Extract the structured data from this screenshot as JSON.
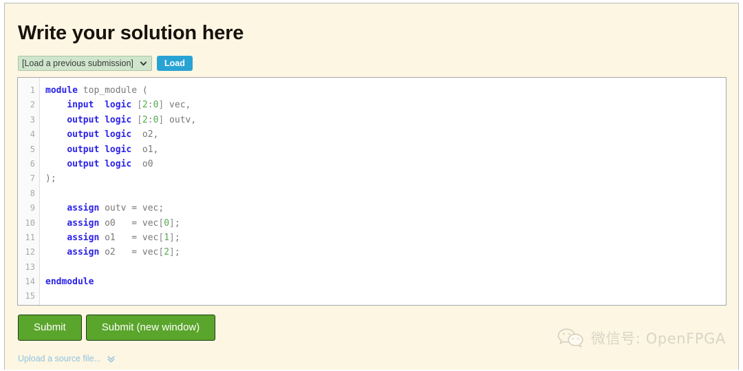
{
  "page": {
    "title": "Write your solution here",
    "background_color": "#fdf6e3"
  },
  "load_row": {
    "select": {
      "selected": "[Load a previous submission]",
      "options": [
        "[Load a previous submission]"
      ],
      "caret_icon": "chevron-down-icon"
    },
    "load_button": {
      "label": "Load",
      "color": "#28a3d4"
    }
  },
  "editor": {
    "line_numbers": [
      "1",
      "2",
      "3",
      "4",
      "5",
      "6",
      "7",
      "8",
      "9",
      "10",
      "11",
      "12",
      "13",
      "14",
      "15"
    ],
    "lines": [
      {
        "n": "1",
        "tokens": [
          {
            "t": "module",
            "c": "kw"
          },
          {
            "t": " top_module (",
            "c": "id"
          }
        ]
      },
      {
        "n": "2",
        "tokens": [
          {
            "t": "    ",
            "c": "id"
          },
          {
            "t": "input",
            "c": "kw"
          },
          {
            "t": "  ",
            "c": "id"
          },
          {
            "t": "logic",
            "c": "kw"
          },
          {
            "t": " ",
            "c": "id"
          },
          {
            "t": "[",
            "c": "punct"
          },
          {
            "t": "2",
            "c": "num"
          },
          {
            "t": ":",
            "c": "punct"
          },
          {
            "t": "0",
            "c": "num"
          },
          {
            "t": "]",
            "c": "punct"
          },
          {
            "t": " vec,",
            "c": "id"
          }
        ]
      },
      {
        "n": "3",
        "tokens": [
          {
            "t": "    ",
            "c": "id"
          },
          {
            "t": "output",
            "c": "kw"
          },
          {
            "t": " ",
            "c": "id"
          },
          {
            "t": "logic",
            "c": "kw"
          },
          {
            "t": " ",
            "c": "id"
          },
          {
            "t": "[",
            "c": "punct"
          },
          {
            "t": "2",
            "c": "num"
          },
          {
            "t": ":",
            "c": "punct"
          },
          {
            "t": "0",
            "c": "num"
          },
          {
            "t": "]",
            "c": "punct"
          },
          {
            "t": " outv,",
            "c": "id"
          }
        ]
      },
      {
        "n": "4",
        "tokens": [
          {
            "t": "    ",
            "c": "id"
          },
          {
            "t": "output",
            "c": "kw"
          },
          {
            "t": " ",
            "c": "id"
          },
          {
            "t": "logic",
            "c": "kw"
          },
          {
            "t": "  o2,",
            "c": "id"
          }
        ]
      },
      {
        "n": "5",
        "tokens": [
          {
            "t": "    ",
            "c": "id"
          },
          {
            "t": "output",
            "c": "kw"
          },
          {
            "t": " ",
            "c": "id"
          },
          {
            "t": "logic",
            "c": "kw"
          },
          {
            "t": "  o1,",
            "c": "id"
          }
        ]
      },
      {
        "n": "6",
        "tokens": [
          {
            "t": "    ",
            "c": "id"
          },
          {
            "t": "output",
            "c": "kw"
          },
          {
            "t": " ",
            "c": "id"
          },
          {
            "t": "logic",
            "c": "kw"
          },
          {
            "t": "  o0",
            "c": "id"
          }
        ]
      },
      {
        "n": "7",
        "tokens": [
          {
            "t": ");",
            "c": "id"
          }
        ]
      },
      {
        "n": "8",
        "tokens": [
          {
            "t": "",
            "c": "id"
          }
        ]
      },
      {
        "n": "9",
        "tokens": [
          {
            "t": "    ",
            "c": "id"
          },
          {
            "t": "assign",
            "c": "kw"
          },
          {
            "t": " outv = vec;",
            "c": "id"
          }
        ]
      },
      {
        "n": "10",
        "tokens": [
          {
            "t": "    ",
            "c": "id"
          },
          {
            "t": "assign",
            "c": "kw"
          },
          {
            "t": " o0   = vec",
            "c": "id"
          },
          {
            "t": "[",
            "c": "punct"
          },
          {
            "t": "0",
            "c": "num"
          },
          {
            "t": "]",
            "c": "punct"
          },
          {
            "t": ";",
            "c": "id"
          }
        ]
      },
      {
        "n": "11",
        "tokens": [
          {
            "t": "    ",
            "c": "id"
          },
          {
            "t": "assign",
            "c": "kw"
          },
          {
            "t": " o1   = vec",
            "c": "id"
          },
          {
            "t": "[",
            "c": "punct"
          },
          {
            "t": "1",
            "c": "num"
          },
          {
            "t": "]",
            "c": "punct"
          },
          {
            "t": ";",
            "c": "id"
          }
        ]
      },
      {
        "n": "12",
        "tokens": [
          {
            "t": "    ",
            "c": "id"
          },
          {
            "t": "assign",
            "c": "kw"
          },
          {
            "t": " o2   = vec",
            "c": "id"
          },
          {
            "t": "[",
            "c": "punct"
          },
          {
            "t": "2",
            "c": "num"
          },
          {
            "t": "]",
            "c": "punct"
          },
          {
            "t": ";",
            "c": "id"
          }
        ]
      },
      {
        "n": "13",
        "tokens": [
          {
            "t": "",
            "c": "id"
          }
        ]
      },
      {
        "n": "14",
        "tokens": [
          {
            "t": "endmodule",
            "c": "kw"
          }
        ]
      },
      {
        "n": "15",
        "tokens": [
          {
            "t": "",
            "c": "id"
          }
        ]
      }
    ],
    "colors": {
      "keyword": "#2a21e8",
      "number": "#4fa84f",
      "identifier": "#777777",
      "background": "#ffffff"
    }
  },
  "actions": {
    "submit_label": "Submit",
    "submit_new_window_label": "Submit (new window)",
    "button_color": "#5aa52b",
    "upload_label": "Upload a source file...",
    "upload_caret_icon": "double-chevron-down-icon"
  },
  "watermark": {
    "icon": "wechat-icon",
    "text": "微信号: OpenFPGA"
  }
}
